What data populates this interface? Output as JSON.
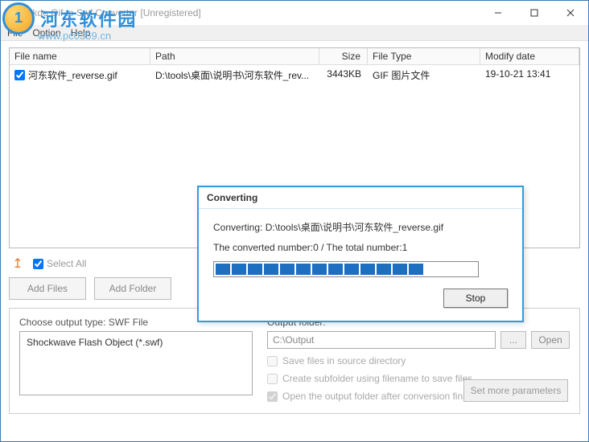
{
  "window": {
    "title": "Okdo Gif to Swf Converter [Unregistered]"
  },
  "watermark": {
    "brand": "河东软件园",
    "url": "www.pc0359.cn"
  },
  "menu": {
    "file": "File",
    "option": "Option",
    "help": "Help"
  },
  "table": {
    "cols": {
      "filename": "File name",
      "path": "Path",
      "size": "Size",
      "filetype": "File Type",
      "modify": "Modify date"
    },
    "rows": [
      {
        "checked": true,
        "filename": "河东软件_reverse.gif",
        "path": "D:\\tools\\桌面\\说明书\\河东软件_rev...",
        "size": "3443KB",
        "filetype": "GIF 图片文件",
        "modify": "19-10-21 13:41"
      }
    ]
  },
  "controls": {
    "select_all": "Select All",
    "add_files": "Add Files",
    "add_folder": "Add Folder"
  },
  "output": {
    "choose_type_label": "Choose output type:  SWF File",
    "type_desc": "Shockwave Flash Object (*.swf)",
    "folder_label": "Output folder:",
    "folder_value": "C:\\Output",
    "browse": "...",
    "open": "Open",
    "opt_save_src": "Save files in source directory",
    "opt_subfolder": "Create subfolder using filename to save files",
    "opt_open_after": "Open the output folder after conversion finished",
    "set_more": "Set more parameters"
  },
  "dialog": {
    "title": "Converting",
    "line1_prefix": "Converting:  ",
    "line1_path": "D:\\tools\\桌面\\说明书\\河东软件_reverse.gif",
    "line2": "The converted number:0  /  The total number:1",
    "segments_on": 13,
    "segments_total": 17,
    "stop": "Stop"
  }
}
